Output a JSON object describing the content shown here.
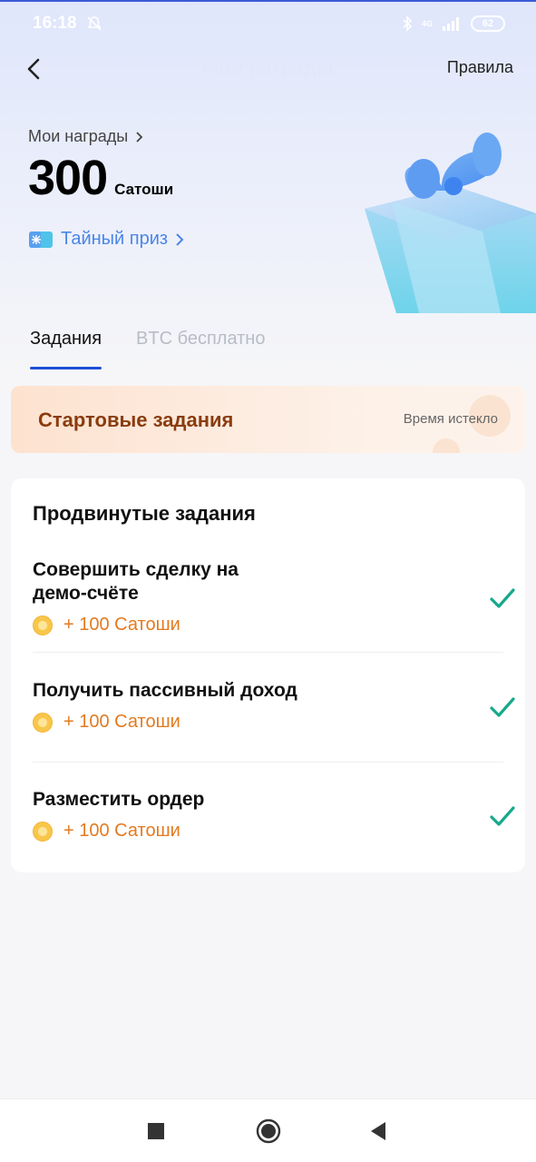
{
  "status_bar": {
    "time": "16:18",
    "network": "4G",
    "battery": "62"
  },
  "header": {
    "title": "Мои награды",
    "rules_label": "Правила"
  },
  "rewards": {
    "label": "Мои награды",
    "amount": "300",
    "unit": "Сатоши",
    "secret_prize": "Тайный приз"
  },
  "tabs": [
    {
      "label": "Задания",
      "active": true
    },
    {
      "label": "BTC бесплатно",
      "active": false
    }
  ],
  "start_tasks": {
    "title": "Стартовые задания",
    "status": "Время истекло"
  },
  "advanced": {
    "title": "Продвинутые задания",
    "tasks": [
      {
        "title_line1": "Совершить сделку на",
        "title_line2": "демо-счёте",
        "reward": "+ 100 Сатоши",
        "done": true
      },
      {
        "title_line1": "Получить пассивный доход",
        "reward": "+ 100 Сатоши",
        "done": true
      },
      {
        "title_line1": "Разместить ордер",
        "reward": "+ 100 Сатоши",
        "done": true
      }
    ]
  },
  "colors": {
    "accent": "#1f4fd6",
    "reward": "#e37a1f",
    "check": "#17a88b",
    "start_title": "#8a3c0e"
  }
}
